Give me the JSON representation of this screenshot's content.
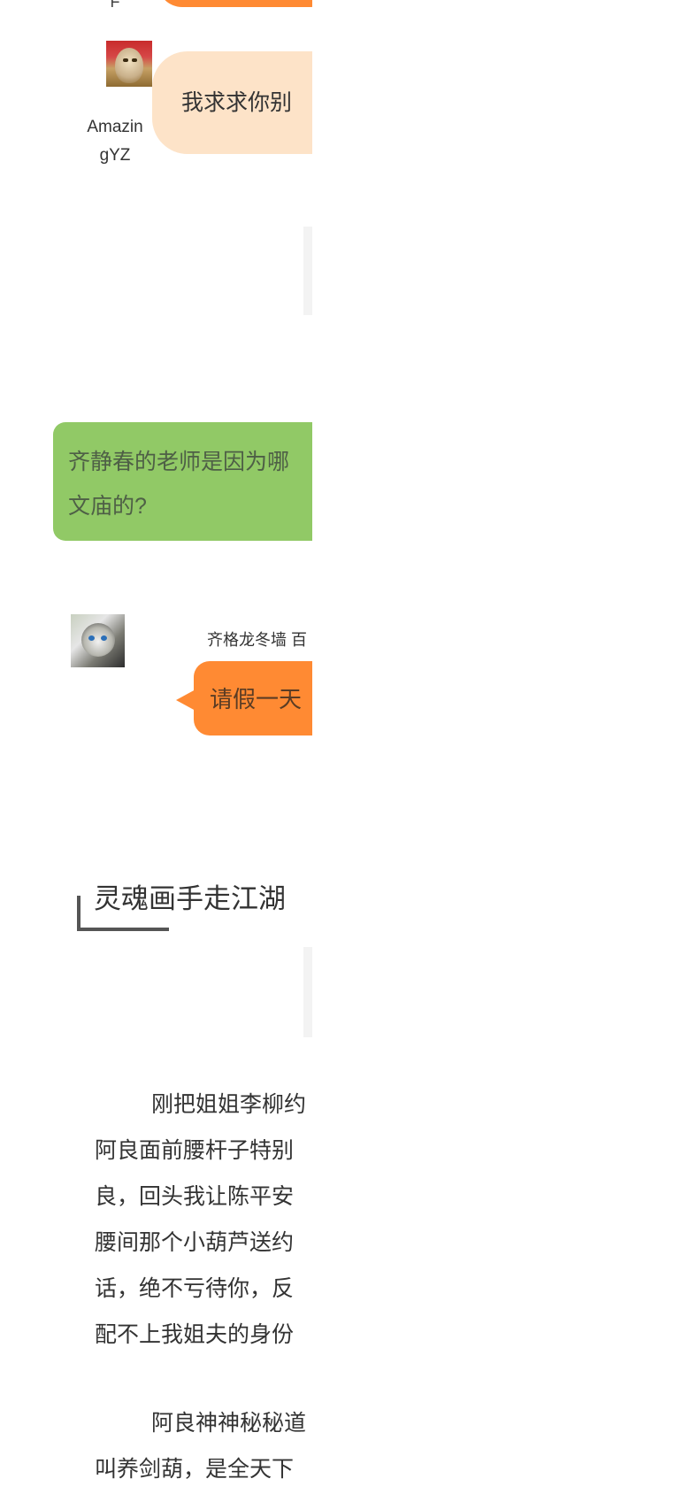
{
  "chat": {
    "previous_user_fragment": "F",
    "messages": [
      {
        "user": "AmazingYZ",
        "user_display_lines": [
          "Amazin",
          "gYZ"
        ],
        "text": "我求求你别"
      },
      {
        "text_lines": [
          "齐静春的老师是因为哪",
          "文庙的?"
        ]
      },
      {
        "user": "齐格龙冬墙",
        "user_suffix": "百",
        "text": "请假一天"
      }
    ]
  },
  "section": {
    "title": "灵魂画手走江湖"
  },
  "article": {
    "paragraph_1_lines": [
      "刚把姐姐李柳约",
      "阿良面前腰杆子特别",
      "良，回头我让陈平安",
      "腰间那个小葫芦送约",
      "话，绝不亏待你，反",
      "配不上我姐夫的身份"
    ],
    "paragraph_2_lines": [
      "阿良神神秘秘道",
      "叫养剑葫，是全天下"
    ]
  }
}
